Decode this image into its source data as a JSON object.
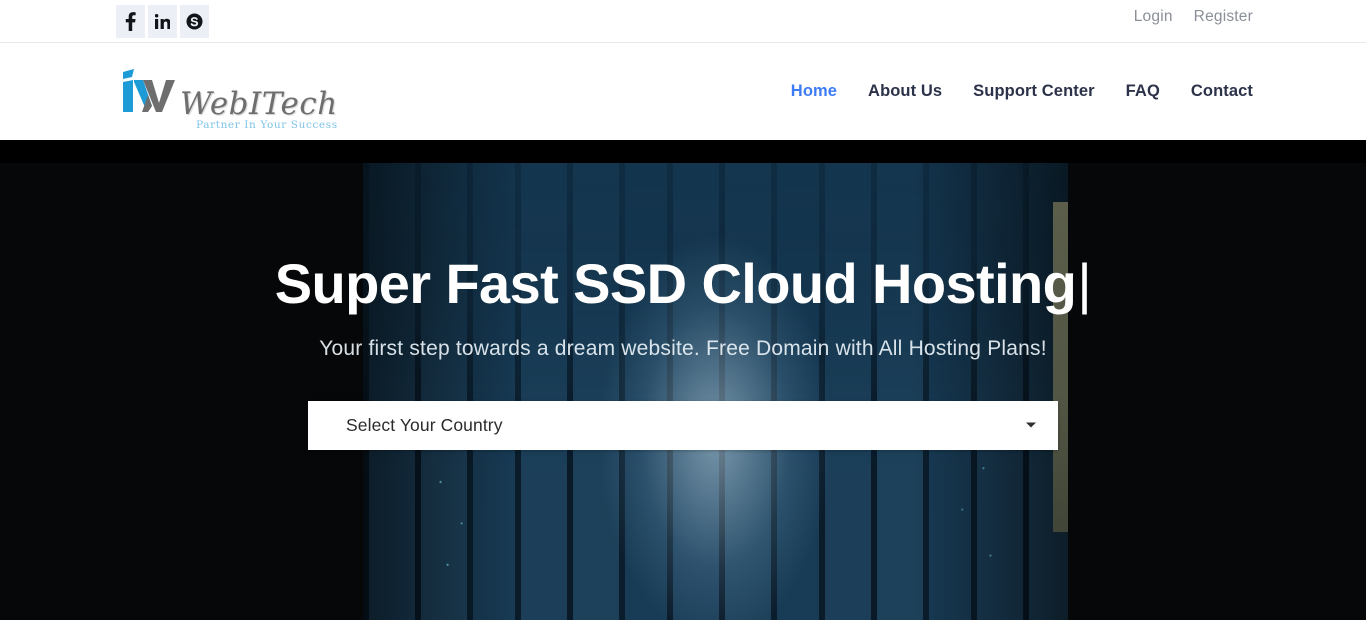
{
  "topbar": {
    "social": [
      {
        "name": "facebook-icon",
        "label": "Facebook"
      },
      {
        "name": "linkedin-icon",
        "label": "LinkedIn"
      },
      {
        "name": "skype-icon",
        "label": "Skype"
      }
    ],
    "login_label": "Login",
    "register_label": "Register"
  },
  "header": {
    "logo": {
      "word": "WebITech",
      "tagline": "Partner In Your Success",
      "mark_blue": "#1d9bd7",
      "mark_gray": "#6e6e6e"
    },
    "nav": [
      {
        "label": "Home",
        "active": true
      },
      {
        "label": "About Us",
        "active": false
      },
      {
        "label": "Support Center",
        "active": false
      },
      {
        "label": "FAQ",
        "active": false
      },
      {
        "label": "Contact",
        "active": false
      }
    ],
    "accent_color": "#3e7cf6"
  },
  "hero": {
    "title": "Super Fast SSD Cloud Hosting",
    "caret": "|",
    "subtitle": "Your first step towards a dream website. Free Domain with All Hosting Plans!",
    "country_select": {
      "selected": "Select Your Country",
      "caret_icon": "chevron-down-icon"
    },
    "background_alt": "data-center-server-racks-photo"
  }
}
